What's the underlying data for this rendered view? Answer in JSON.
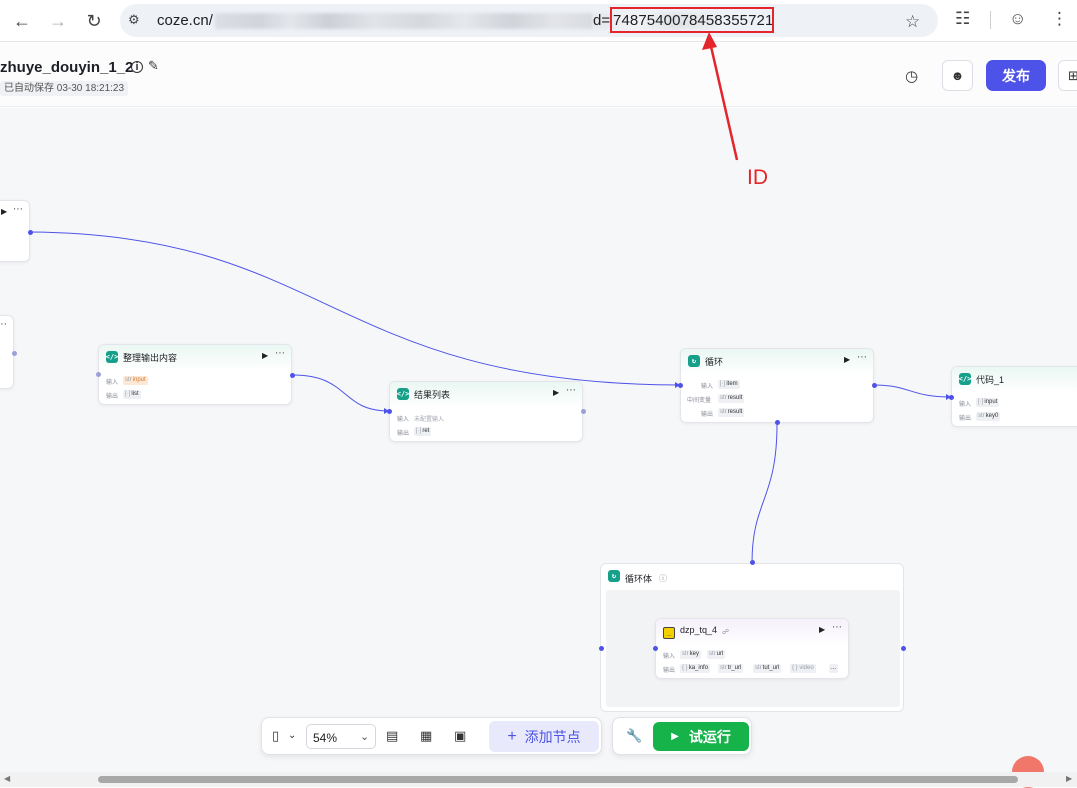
{
  "browser": {
    "url_host": "coze.cn/",
    "url_param": "d=",
    "url_id": "7487540078458355721"
  },
  "annotation": {
    "label": "ID",
    "color": "#e4252b"
  },
  "header": {
    "workflow_name": "zhuye_douyin_1_2",
    "save_status": "已自动保存 03-30 18:21:23",
    "publish_label": "发布"
  },
  "nodes": {
    "format_output": {
      "title": "整理输出内容",
      "input_label": "输入",
      "input_tag": "input",
      "input_type": "str",
      "output_label": "输出",
      "output_tag": "list",
      "output_type": "[·]"
    },
    "result_list": {
      "title": "结果列表",
      "input_label": "输入",
      "input_value": "未配置输入",
      "output_label": "输出",
      "output_tag": "ret",
      "output_type": "[·]"
    },
    "loop": {
      "title": "循环",
      "input_label": "输入",
      "input_tag": "item",
      "input_type": "[·]",
      "mid_label": "中间变量",
      "mid_tag": "result",
      "mid_type": "str",
      "output_label": "输出",
      "output_tag": "result",
      "output_type": "str"
    },
    "code_1": {
      "title": "代码_1",
      "input_label": "输入",
      "input_tag": "input",
      "input_type": "[·]",
      "output_label": "输出",
      "output_tag": "key0",
      "output_type": "str"
    },
    "loop_body": {
      "title": "循环体"
    },
    "plugin": {
      "title": "dzp_tq_4",
      "input_label": "输入",
      "input_tag1": "key",
      "input_tag2": "url",
      "input_type": "str",
      "output_label": "输出",
      "output_tag1": "ka_info",
      "output_tag2": "tr_url",
      "output_tag3": "tut_url",
      "output_type1": "{ }",
      "output_type2": "str",
      "output_tag4": "{ } video",
      "output_more": "..."
    }
  },
  "toolbar": {
    "zoom": "54%",
    "add_node_label": "添加节点",
    "test_run_label": "试运行"
  },
  "colors": {
    "accent": "#4d53e8",
    "run_green": "#16b24a",
    "node_icon": "#16a08a"
  }
}
